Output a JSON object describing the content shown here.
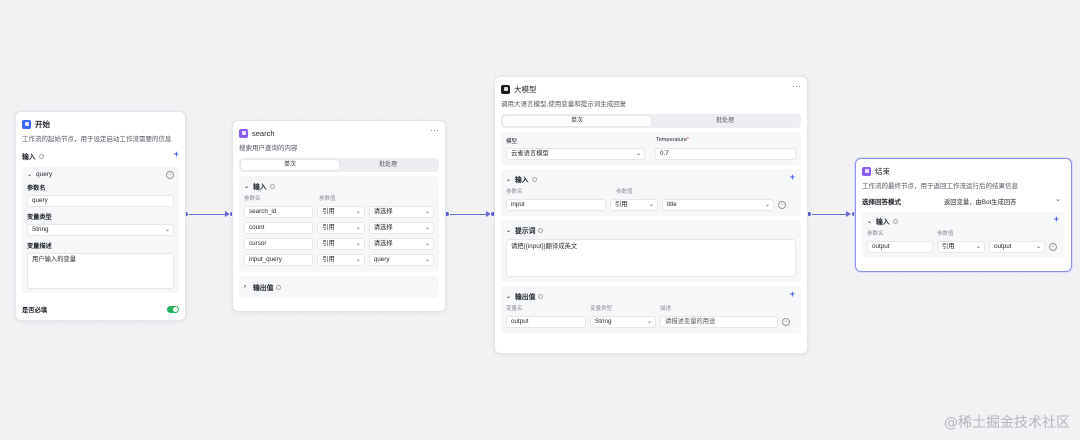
{
  "start_node": {
    "title": "开始",
    "desc": "工作流的起始节点，用于设定启动工作流需要的信息",
    "input_label": "输入",
    "param_row": "query",
    "param_name_label": "参数名",
    "param_name_value": "query",
    "param_type_label": "变量类型",
    "param_type_value": "String",
    "param_desc_label": "变量描述",
    "param_desc_value": "用户输入的变量",
    "required_label": "是否必填"
  },
  "search_node": {
    "title": "search",
    "desc": "搜索用户查询的内容",
    "tab_single": "单次",
    "tab_batch": "批处理",
    "input_label": "输入",
    "col_param": "参数名",
    "col_value": "参数值",
    "rows": [
      {
        "name": "search_id",
        "mode": "引用",
        "value": "请选择"
      },
      {
        "name": "count",
        "mode": "引用",
        "value": "请选择"
      },
      {
        "name": "cursor",
        "mode": "引用",
        "value": "请选择"
      },
      {
        "name": "input_query",
        "mode": "引用",
        "value": "query"
      }
    ],
    "output_label": "输出值"
  },
  "llm_node": {
    "title": "大模型",
    "desc": "调用大语言模型,使用变量和提示词生成回复",
    "tab_single": "单次",
    "tab_batch": "批处理",
    "model_label": "模型",
    "model_value": "云雀语言模型",
    "temp_label": "Temperature",
    "temp_value": "0.7",
    "input_label": "输入",
    "col_param": "参数名",
    "col_value": "参数值",
    "input_row": {
      "name": "input",
      "mode": "引用",
      "value": "title"
    },
    "prompt_label": "提示词",
    "prompt_value": "请把{{input}}翻译成英文",
    "output_label": "输出值",
    "out_col_name": "变量名",
    "out_col_type": "变量类型",
    "out_col_desc": "描述",
    "output_row": {
      "name": "output",
      "type": "String",
      "desc": "请描述变量的用途"
    }
  },
  "end_node": {
    "title": "结束",
    "desc": "工作流的最终节点，用于返回工作流运行后的结果信息",
    "mode_label": "选择回答模式",
    "mode_value": "返回变量，由Bot生成回答",
    "input_label": "输入",
    "col_param": "参数名",
    "col_value": "参数值",
    "row": {
      "name": "output",
      "mode": "引用",
      "value": "output"
    }
  },
  "watermark": "@稀土掘金技术社区",
  "colors": {
    "accent": "#5b5bd6",
    "toggle_on": "#22b35e",
    "selected_border": "#8f8ff0"
  }
}
